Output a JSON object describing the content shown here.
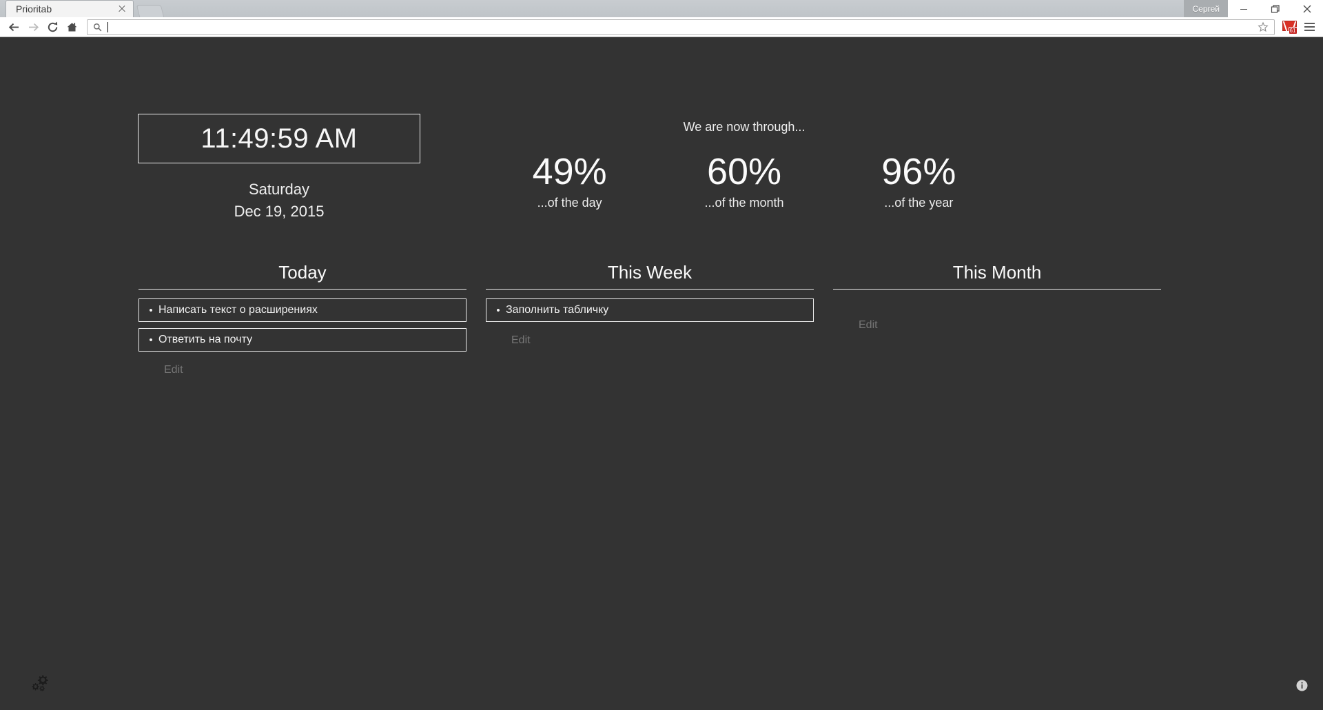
{
  "browser": {
    "tab": {
      "title": "Prioritab",
      "close_icon": "close-icon",
      "new_tab_icon": "new-tab-icon"
    },
    "profile": {
      "name": "Сергей"
    },
    "window_controls": {
      "minimize": "minimize-icon",
      "restore": "restore-icon",
      "close": "close-icon"
    },
    "toolbar": {
      "back_icon": "back-arrow-icon",
      "forward_icon": "forward-arrow-icon",
      "reload_icon": "reload-icon",
      "home_icon": "home-icon",
      "omnibox_search_icon": "search-icon",
      "omnibox_value": "",
      "omnibox_placeholder": "",
      "bookmark_icon": "star-icon",
      "extension_icon": "gmail-icon",
      "extension_badge": "61",
      "menu_icon": "hamburger-menu-icon"
    }
  },
  "newtab": {
    "clock": {
      "time": "11:49:59 AM",
      "day_name": "Saturday",
      "date": "Dec 19, 2015"
    },
    "progress": {
      "heading": "We are now through...",
      "cells": [
        {
          "percent": "49%",
          "label": "...of the day"
        },
        {
          "percent": "60%",
          "label": "...of the month"
        },
        {
          "percent": "96%",
          "label": "...of the year"
        }
      ]
    },
    "columns": [
      {
        "title": "Today",
        "edit_label": "Edit",
        "tasks": [
          {
            "bullet": "•",
            "text": "Написать текст о расширениях"
          },
          {
            "bullet": "•",
            "text": "Ответить на почту"
          }
        ]
      },
      {
        "title": "This Week",
        "edit_label": "Edit",
        "tasks": [
          {
            "bullet": "•",
            "text": "Заполнить табличку"
          }
        ]
      },
      {
        "title": "This Month",
        "edit_label": "Edit",
        "tasks": []
      }
    ],
    "settings_icon": "gears-settings-icon",
    "info_icon": "info-icon"
  },
  "colors": {
    "page_background": "#333333",
    "text_primary": "#f2f2f2",
    "text_muted": "#767676",
    "border": "#f0f0f0",
    "extension_badge": "#c5221f"
  }
}
